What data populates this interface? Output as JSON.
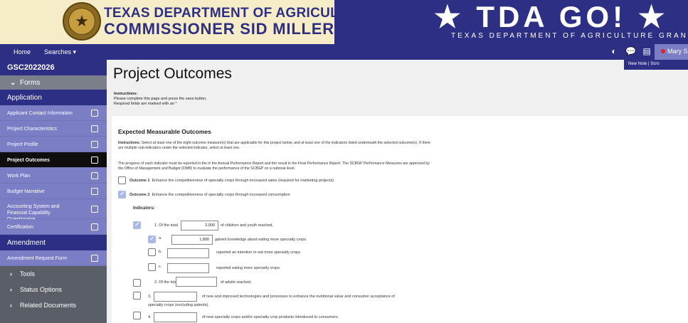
{
  "banner": {
    "agency_line1": "TEXAS DEPARTMENT OF AGRICULTURE",
    "agency_line2": "COMMISSIONER SID MILLER",
    "logo_text": "★ TDA GO! ★",
    "logo_subtitle": "TEXAS DEPARTMENT OF AGRICULTURE GRANTS ONLINE"
  },
  "topnav": {
    "home": "Home",
    "searches": "Searches ▾",
    "user": "Mary Sue",
    "icons": [
      "contrast-icon",
      "chat-icon",
      "document-icon"
    ]
  },
  "subnav": {
    "new_note": "New Note",
    "separator": "|",
    "scroll_link": "Scro"
  },
  "sidebar": {
    "grant_id": "GSC2022026",
    "forms": "Forms",
    "application_header": "Application",
    "items": [
      {
        "label": "Applicant Contact Information"
      },
      {
        "label": "Project Characteristics"
      },
      {
        "label": "Project Profile"
      },
      {
        "label": "Project Outcomes"
      },
      {
        "label": "Work Plan"
      },
      {
        "label": "Budget Narrative"
      },
      {
        "label": "Accounting System and Financial Capability Questionaire"
      },
      {
        "label": "Certification"
      }
    ],
    "amendment_header": "Amendment",
    "amendment_items": [
      {
        "label": "Amendment Request Form"
      }
    ],
    "links": [
      {
        "label": "Tools"
      },
      {
        "label": "Status Options"
      },
      {
        "label": "Related Documents"
      }
    ]
  },
  "page": {
    "title": "Project Outcomes",
    "instructions_label": "Instructions:",
    "instructions_line": "Please complete this page and press the save button.",
    "required_note": "Required fields are marked with an",
    "required_mark": "*"
  },
  "card": {
    "heading": "Expected Measurable Outcomes",
    "instructions_label": "Instructions:",
    "instructions_text": "Select at least one of the eight outcome measure(s) that are applicable for this project below, and at least one of the indicators listed underneath the selected outcome(s). If there are multiple sub-indicators under the selected indicator, select at least one.",
    "progress_text": "The progress of each indicator must be reported in the in the Annual Performance Report and the result in the Final Performance Report. The SCBGP Performance Measures are approved by the Office of Management and Budget (OMB) to evaluate the performance of the SCBGP on a national level.",
    "outcome1_label": "Outcome 1",
    "outcome1_text": "Enhance the competitiveness of specialty crops through increased sales (required for marketing projects)",
    "outcome2_label": "Outcome 2",
    "outcome2_text": "Enhance the competitiveness of specialty crops through increased consumption",
    "indicators_label": "Indicators:",
    "ind1_prefix": "1. Of the total",
    "ind1_value": "2,000",
    "ind1_suffix": "of children and youth reached,",
    "ind1a_letter": "a.",
    "ind1a_value": "1,800",
    "ind1a_suffix": "gained knowledge about eating more specialty crops.",
    "ind1b_letter": "b.",
    "ind1b_value": "",
    "ind1b_suffix": "reported an intention to eat more specialty crops.",
    "ind1c_letter": "c.",
    "ind1c_value": "",
    "ind1c_suffix": "reported eating more specialty crops.",
    "ind2_prefix": "2. Of the total",
    "ind2_value": "",
    "ind2_suffix": "of adults reached,",
    "ind3_prefix": "3.",
    "ind3_value": "",
    "ind3_suffix": "of new and improved technologies and processes to enhance the nutritional value and consumer acceptance of",
    "ind3_suffix2": "specialty crops (excluding patents).",
    "ind4_prefix": "4.",
    "ind4_value": "",
    "ind4_suffix": "of new specialty crops and/or specialty crop products introduced to consumers."
  },
  "colors": {
    "navy": "#2d2f84",
    "periwinkle": "#7b7ec4",
    "cream": "#f6ecc8",
    "checked": "#a9b8e9"
  }
}
